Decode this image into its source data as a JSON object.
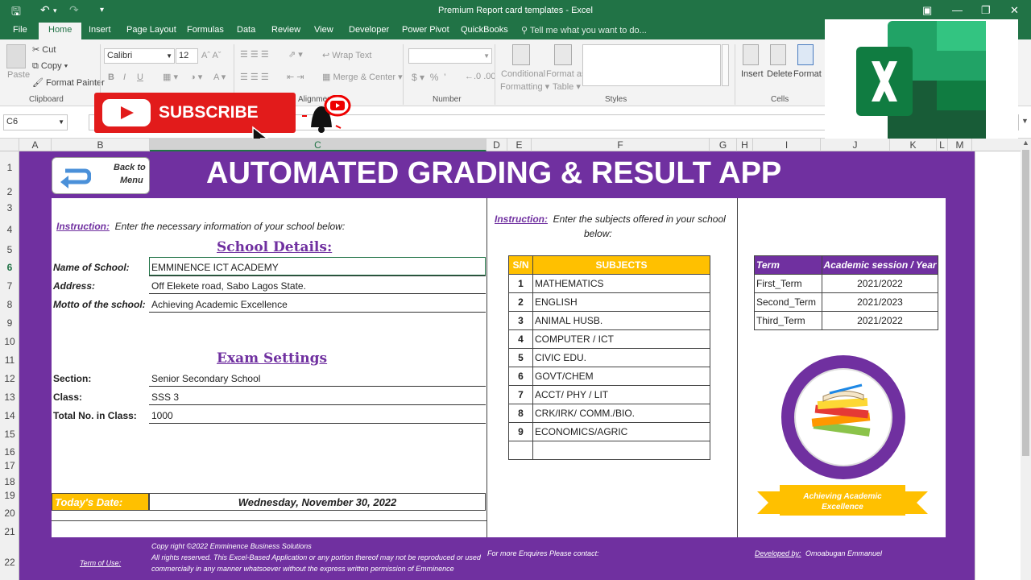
{
  "window": {
    "title": "Premium Report card templates - Excel"
  },
  "tabs": [
    "File",
    "Home",
    "Insert",
    "Page Layout",
    "Formulas",
    "Data",
    "Review",
    "View",
    "Developer",
    "Power Pivot",
    "QuickBooks",
    "Tell me what you want to do..."
  ],
  "ribbon": {
    "cut": "Cut",
    "copy": "Copy",
    "format_painter": "Format Painter",
    "paste": "Paste",
    "font": "Calibri",
    "size": "12",
    "bold": "B",
    "italic": "I",
    "underline": "U",
    "wrap_text": "Wrap Text",
    "merge_center": "Merge & Center",
    "cond_format": "Conditional",
    "cond_format2": "Formatting",
    "format_table": "Format as",
    "format_table2": "Table",
    "insert": "Insert",
    "delete": "Delete",
    "format": "Format",
    "groups": {
      "clipboard": "Clipboard",
      "alignment": "Alignment",
      "number": "Number",
      "styles": "Styles",
      "cells": "Cells"
    }
  },
  "name_box": "C6",
  "overlay": {
    "subscribe": "SUBSCRIBE"
  },
  "columns": [
    "A",
    "B",
    "C",
    "D",
    "E",
    "F",
    "G",
    "H",
    "I",
    "J",
    "K",
    "L",
    "M"
  ],
  "rows": [
    "1",
    "2",
    "3",
    "4",
    "5",
    "6",
    "7",
    "8",
    "9",
    "10",
    "11",
    "12",
    "13",
    "14",
    "15",
    "16",
    "17",
    "18",
    "19",
    "20",
    "21",
    "22"
  ],
  "app": {
    "title": "AUTOMATED GRADING & RESULT APP",
    "back_line1": "Back to",
    "back_line2": "Menu",
    "instruction_label": "Instruction:",
    "instruction_text": "Enter the necessary information of your school below:",
    "school_heading": "School Details:",
    "school_fields": [
      {
        "label": "Name of School:",
        "value": "EMMINENCE ICT ACADEMY"
      },
      {
        "label": "Address:",
        "value": "Off Elekete road, Sabo Lagos State."
      },
      {
        "label": "Motto of the school:",
        "value": "Achieving Academic Excellence"
      }
    ],
    "exam_heading": "Exam Settings",
    "exam_fields": [
      {
        "label": "Section:",
        "value": "Senior Secondary School"
      },
      {
        "label": "Class:",
        "value": "SSS 3"
      },
      {
        "label": "Total No. in Class:",
        "value": "1000"
      }
    ],
    "today_label": "Today's Date:",
    "today_value": "Wednesday, November 30, 2022",
    "subjects_instruction_label": "Instruction:",
    "subjects_instruction_text1": "Enter the subjects offered in your school",
    "subjects_instruction_text2": "below:",
    "subjects_header": {
      "sn": "S/N",
      "subject": "SUBJECTS"
    },
    "subjects": [
      {
        "sn": "1",
        "name": "MATHEMATICS"
      },
      {
        "sn": "2",
        "name": "ENGLISH"
      },
      {
        "sn": "3",
        "name": "ANIMAL HUSB."
      },
      {
        "sn": "4",
        "name": "COMPUTER / ICT"
      },
      {
        "sn": "5",
        "name": "CIVIC EDU."
      },
      {
        "sn": "6",
        "name": "GOVT/CHEM"
      },
      {
        "sn": "7",
        "name": "ACCT/ PHY / LIT"
      },
      {
        "sn": "8",
        "name": "CRK/IRK/ COMM./BIO."
      },
      {
        "sn": "9",
        "name": "ECONOMICS/AGRIC"
      },
      {
        "sn": "",
        "name": ""
      }
    ],
    "term_header": {
      "term": "Term",
      "session": "Academic session / Year"
    },
    "terms": [
      {
        "term": "First_Term",
        "session": "2021/2022"
      },
      {
        "term": "Second_Term",
        "session": "2021/2023"
      },
      {
        "term": "Third_Term",
        "session": "2021/2022"
      }
    ],
    "ribbon_banner": "Achieving Academic Excellence",
    "footer": {
      "term_of_use": "Term of Use:",
      "copyright1": "Copy right ©2022 Emminence Business Solutions",
      "copyright2": "All rights reserved. This Excel-Based Application or any portion thereof may not be reproduced or used",
      "copyright3": "commercially in any manner whatsoever without the express written permission of Emminence",
      "enquiries": "For more Enquires Please contact:",
      "developed_by": "Developed by:",
      "developer": "Omoabugan Emmanuel"
    }
  },
  "colors": {
    "excel_green": "#217346",
    "purple": "#7030a0",
    "gold": "#ffc000",
    "red": "#e00000"
  }
}
